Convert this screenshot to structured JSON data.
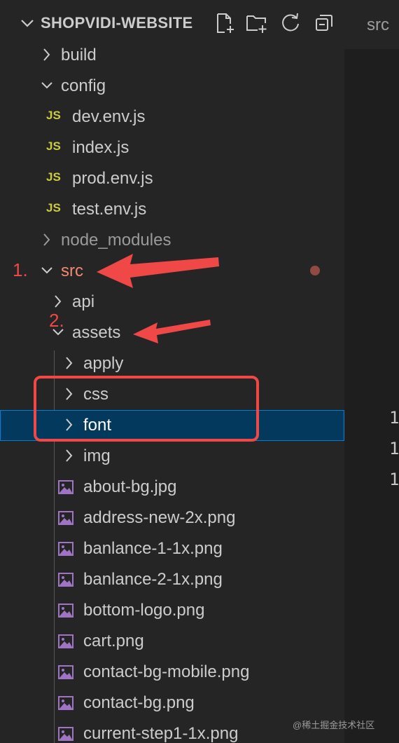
{
  "explorer": {
    "title": "SHOPVIDI-WEBSITE",
    "actions": [
      {
        "name": "new-file-icon"
      },
      {
        "name": "new-folder-icon"
      },
      {
        "name": "refresh-icon"
      },
      {
        "name": "collapse-all-icon"
      }
    ]
  },
  "tree": [
    {
      "label": "build",
      "type": "folder",
      "expanded": false,
      "depth": 1
    },
    {
      "label": "config",
      "type": "folder",
      "expanded": true,
      "depth": 1
    },
    {
      "label": "dev.env.js",
      "type": "js",
      "depth": 2
    },
    {
      "label": "index.js",
      "type": "js",
      "depth": 2
    },
    {
      "label": "prod.env.js",
      "type": "js",
      "depth": 2
    },
    {
      "label": "test.env.js",
      "type": "js",
      "depth": 2
    },
    {
      "label": "node_modules",
      "type": "folder",
      "expanded": false,
      "depth": 1,
      "dimmed": true
    },
    {
      "label": "src",
      "type": "folder",
      "expanded": true,
      "depth": 1,
      "modified": true
    },
    {
      "label": "api",
      "type": "folder",
      "expanded": false,
      "depth": 2
    },
    {
      "label": "assets",
      "type": "folder",
      "expanded": true,
      "depth": 2
    },
    {
      "label": "apply",
      "type": "folder",
      "expanded": false,
      "depth": 3
    },
    {
      "label": "css",
      "type": "folder",
      "expanded": false,
      "depth": 3
    },
    {
      "label": "font",
      "type": "folder",
      "expanded": false,
      "depth": 3,
      "selected": true
    },
    {
      "label": "img",
      "type": "folder",
      "expanded": false,
      "depth": 3
    },
    {
      "label": "about-bg.jpg",
      "type": "image",
      "depth": 3
    },
    {
      "label": "address-new-2x.png",
      "type": "image",
      "depth": 3
    },
    {
      "label": "banlance-1-1x.png",
      "type": "image",
      "depth": 3
    },
    {
      "label": "banlance-2-1x.png",
      "type": "image",
      "depth": 3
    },
    {
      "label": "bottom-logo.png",
      "type": "image",
      "depth": 3
    },
    {
      "label": "cart.png",
      "type": "image",
      "depth": 3
    },
    {
      "label": "contact-bg-mobile.png",
      "type": "image",
      "depth": 3
    },
    {
      "label": "contact-bg.png",
      "type": "image",
      "depth": 3
    },
    {
      "label": "current-step1-1x.png",
      "type": "image",
      "depth": 3
    }
  ],
  "js_badge": "JS",
  "editor": {
    "tab_label": "src",
    "line_numbers": [
      "1",
      "1",
      "1"
    ]
  },
  "annotations": {
    "step1": "1.",
    "step2": "2.",
    "arrow_color": "#f04747",
    "box_color": "#f04747"
  },
  "colors": {
    "sidebar_bg": "#252526",
    "selected_bg": "#04395e",
    "selected_border": "#007fd4",
    "modified_text": "#f48771",
    "js_yellow": "#cbcb41",
    "image_purple": "#a074c4"
  },
  "watermark": "@稀土掘金技术社区"
}
